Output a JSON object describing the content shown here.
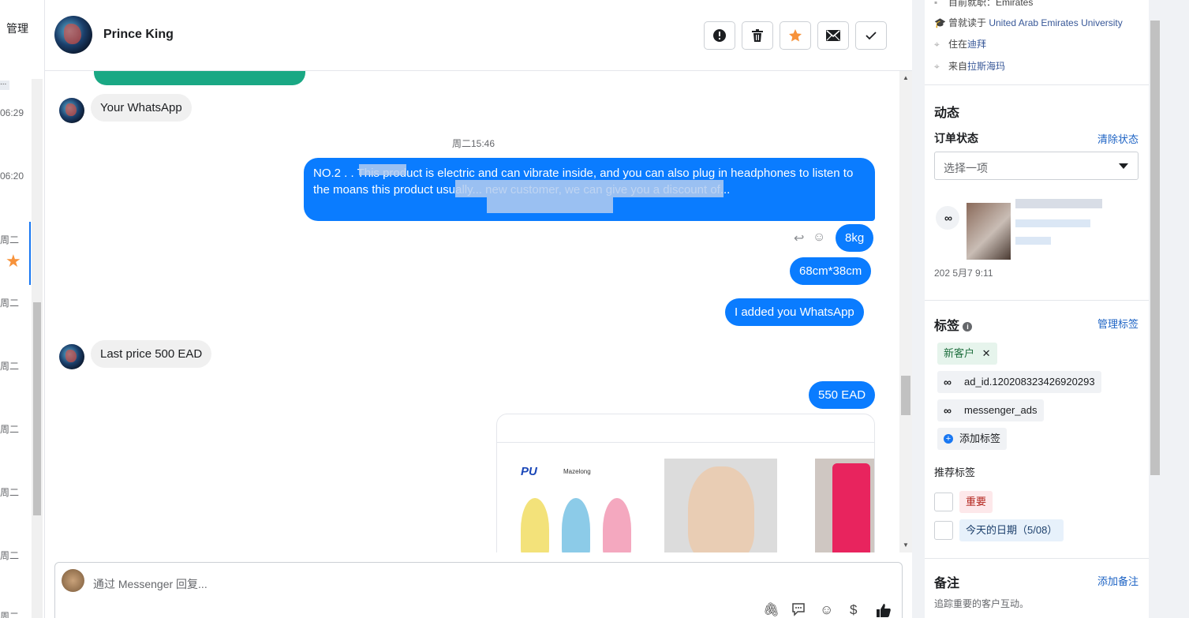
{
  "left_list": {
    "manage_label": "管理",
    "more_label": "...",
    "times": [
      "06:29",
      "06:20",
      "周二",
      "周二",
      "周二",
      "周二",
      "周二",
      "周二",
      "周二"
    ]
  },
  "header": {
    "contact_name": "Prince King",
    "actions": [
      "spam-icon",
      "trash-icon",
      "star-icon",
      "mail-icon",
      "check-icon"
    ],
    "star_color": "#f7923a"
  },
  "messages": {
    "incoming_1": "Your WhatsApp",
    "timestamp_1": "周二15:46",
    "outgoing_long": "NO.2 . . This product is electric and can vibrate inside, and you can also plug in headphones to listen to the moans this product usually... new customer, we can give you a discount of...",
    "outgoing_weight": "8kg",
    "outgoing_size": "68cm*38cm",
    "outgoing_whatsapp": "I added you  WhatsApp",
    "incoming_price": "Last price 500 EAD",
    "outgoing_price": "550 EAD",
    "product_logo_1": "PU",
    "product_logo_2": "Mazelong"
  },
  "composer": {
    "placeholder": "通过 Messenger 回复..."
  },
  "profile": {
    "current_city_label": "目前就职：Emirates",
    "studied_prefix": "曾就读于 ",
    "studied_school": "United Arab Emirates University",
    "lives_prefix": "住在",
    "lives_city": "迪拜",
    "from_prefix": "来自",
    "from_city": "拉斯海玛"
  },
  "activity": {
    "section_title": "动态",
    "order_status_label": "订单状态",
    "clear_status": "清除状态",
    "select_placeholder": "选择一项",
    "post_date": "202  5月7   9:11"
  },
  "tags": {
    "section_title": "标签",
    "manage_tags": "管理标签",
    "items": [
      "新客户",
      "ad_id.120208323426920293",
      "messenger_ads"
    ],
    "add_tag": "添加标签",
    "suggested_title": "推荐标签",
    "suggested": [
      "重要",
      "今天的日期（5/08）"
    ]
  },
  "notes": {
    "section_title": "备注",
    "add_note": "添加备注",
    "hint": "追踪重要的客户互动。"
  },
  "colors": {
    "outgoing_bubble": "#0a7cff",
    "incoming_bubble": "#f0f0f0",
    "link": "#1d63c4"
  }
}
